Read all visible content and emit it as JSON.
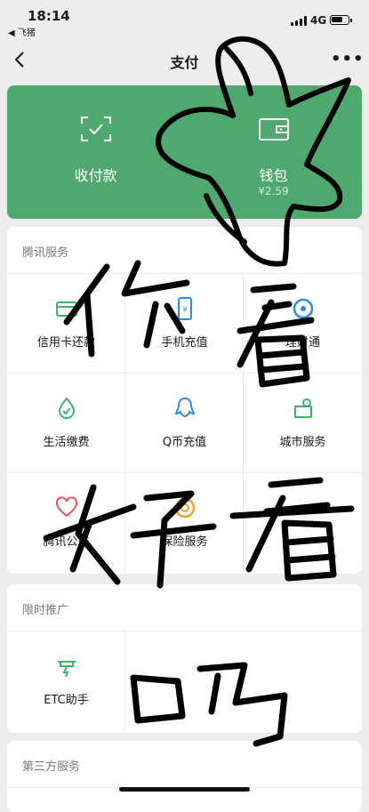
{
  "status_bar": {
    "time": "18:14",
    "back_app": "◀ 飞猪",
    "network": "4G"
  },
  "nav": {
    "title": "支付",
    "more": "•••"
  },
  "wallet_card": {
    "left": {
      "label": "收付款",
      "icon": "scan-receive-icon"
    },
    "right": {
      "label": "钱包",
      "balance": "¥2.59",
      "icon": "wallet-icon"
    }
  },
  "sections": {
    "tencent": {
      "title": "腾讯服务",
      "items": [
        {
          "label": "信用卡还款",
          "icon": "credit-card-icon"
        },
        {
          "label": "手机充值",
          "icon": "phone-recharge-icon"
        },
        {
          "label": "理财通",
          "icon": "wealth-icon"
        },
        {
          "label": "生活缴费",
          "icon": "utility-bill-icon"
        },
        {
          "label": "Q币充值",
          "icon": "qq-coin-icon"
        },
        {
          "label": "城市服务",
          "icon": "city-service-icon"
        },
        {
          "label": "腾讯公益",
          "icon": "charity-heart-icon"
        },
        {
          "label": "保险服务",
          "icon": "insurance-icon"
        }
      ]
    },
    "promo": {
      "title": "限时推广",
      "items": [
        {
          "label": "ETC助手",
          "icon": "etc-icon"
        }
      ]
    },
    "third_party": {
      "title": "第三方服务"
    }
  },
  "handwriting": [
    "你看",
    "好看",
    "吗"
  ],
  "colors": {
    "brand_green": "#4fa86e",
    "accent_blue": "#2a8ee5",
    "accent_red": "#e8505b",
    "accent_orange": "#f0a030",
    "ink": "#000000"
  }
}
